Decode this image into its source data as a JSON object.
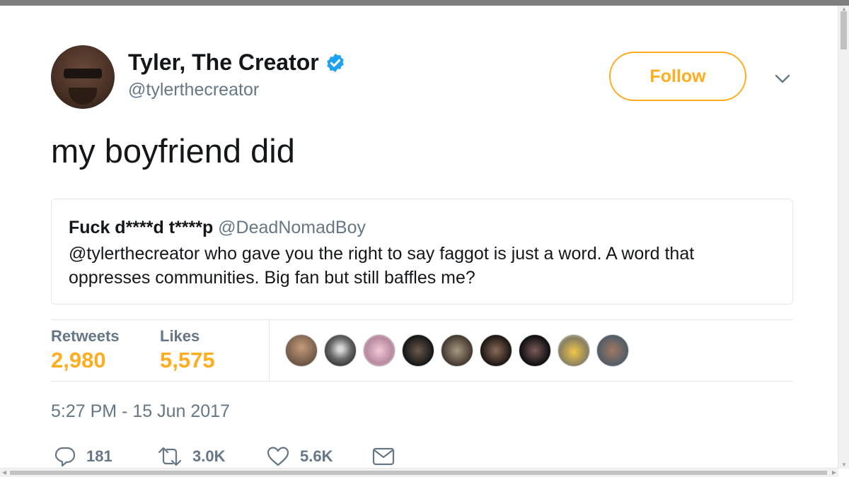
{
  "author": {
    "name": "Tyler, The Creator",
    "handle": "@tylerthecreator",
    "verified": true
  },
  "follow_label": "Follow",
  "tweet_text": "my boyfriend did",
  "quoted_tweet": {
    "name": "Fuck d****d t****p",
    "handle": "@DeadNomadBoy",
    "text": "@tylerthecreator who gave you the right to say faggot is just a word. A word that oppresses communities. Big fan but still baffles me?"
  },
  "stats": {
    "retweets_label": "Retweets",
    "retweets_value": "2,980",
    "likes_label": "Likes",
    "likes_value": "5,575"
  },
  "timestamp": "5:27 PM - 15 Jun 2017",
  "actions": {
    "replies": "181",
    "retweets": "3.0K",
    "likes": "5.6K"
  },
  "colors": {
    "accent": "#ffad1f",
    "secondary_text": "#657786",
    "verified_blue": "#1da1f2",
    "border": "#e1e8ed"
  },
  "icons": [
    "verified-badge-icon",
    "chevron-down-icon",
    "reply-icon",
    "retweet-icon",
    "like-icon",
    "direct-message-icon"
  ]
}
